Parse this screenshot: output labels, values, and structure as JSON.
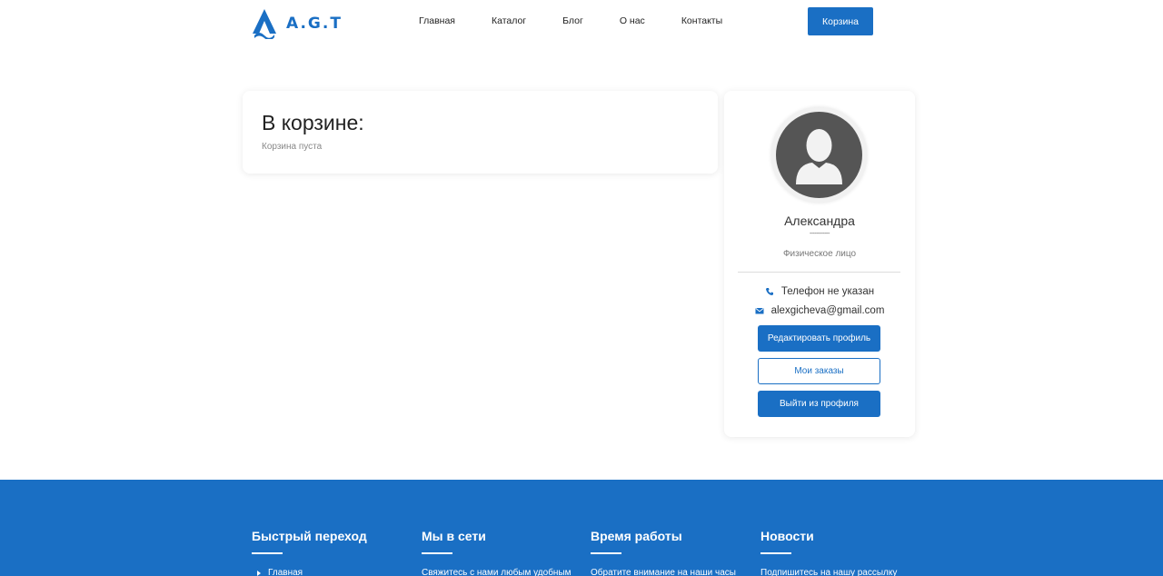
{
  "header": {
    "logo_text": "A.G.T",
    "nav": [
      "Главная",
      "Каталог",
      "Блог",
      "О нас",
      "Контакты"
    ],
    "cart_button": "Корзина"
  },
  "cart": {
    "title": "В корзине:",
    "empty_text": "Корзина пуста"
  },
  "profile": {
    "name": "Александра",
    "dashes": "------------",
    "type": "Физическое лицо",
    "phone": "Телефон не указан",
    "email": "alexgicheva@gmail.com",
    "edit_button": "Редактировать профиль",
    "orders_button": "Мои заказы",
    "logout_button": "Выйти из профиля"
  },
  "footer": {
    "columns": [
      {
        "title": "Быстрый переход",
        "text": "Главная"
      },
      {
        "title": "Мы в сети",
        "text": "Свяжитесь с нами любым удобным"
      },
      {
        "title": "Время работы",
        "text": "Обратите внимание на наши часы"
      },
      {
        "title": "Новости",
        "text": "Подпишитесь на нашу рассылку"
      }
    ]
  },
  "colors": {
    "accent": "#1a6fc4",
    "avatar_bg": "#555555"
  },
  "icons": {
    "logo": "agt-logo-icon",
    "phone": "phone-icon",
    "email": "envelope-icon",
    "avatar": "user-silhouette-icon",
    "footer_link": "triangle-right-icon"
  }
}
